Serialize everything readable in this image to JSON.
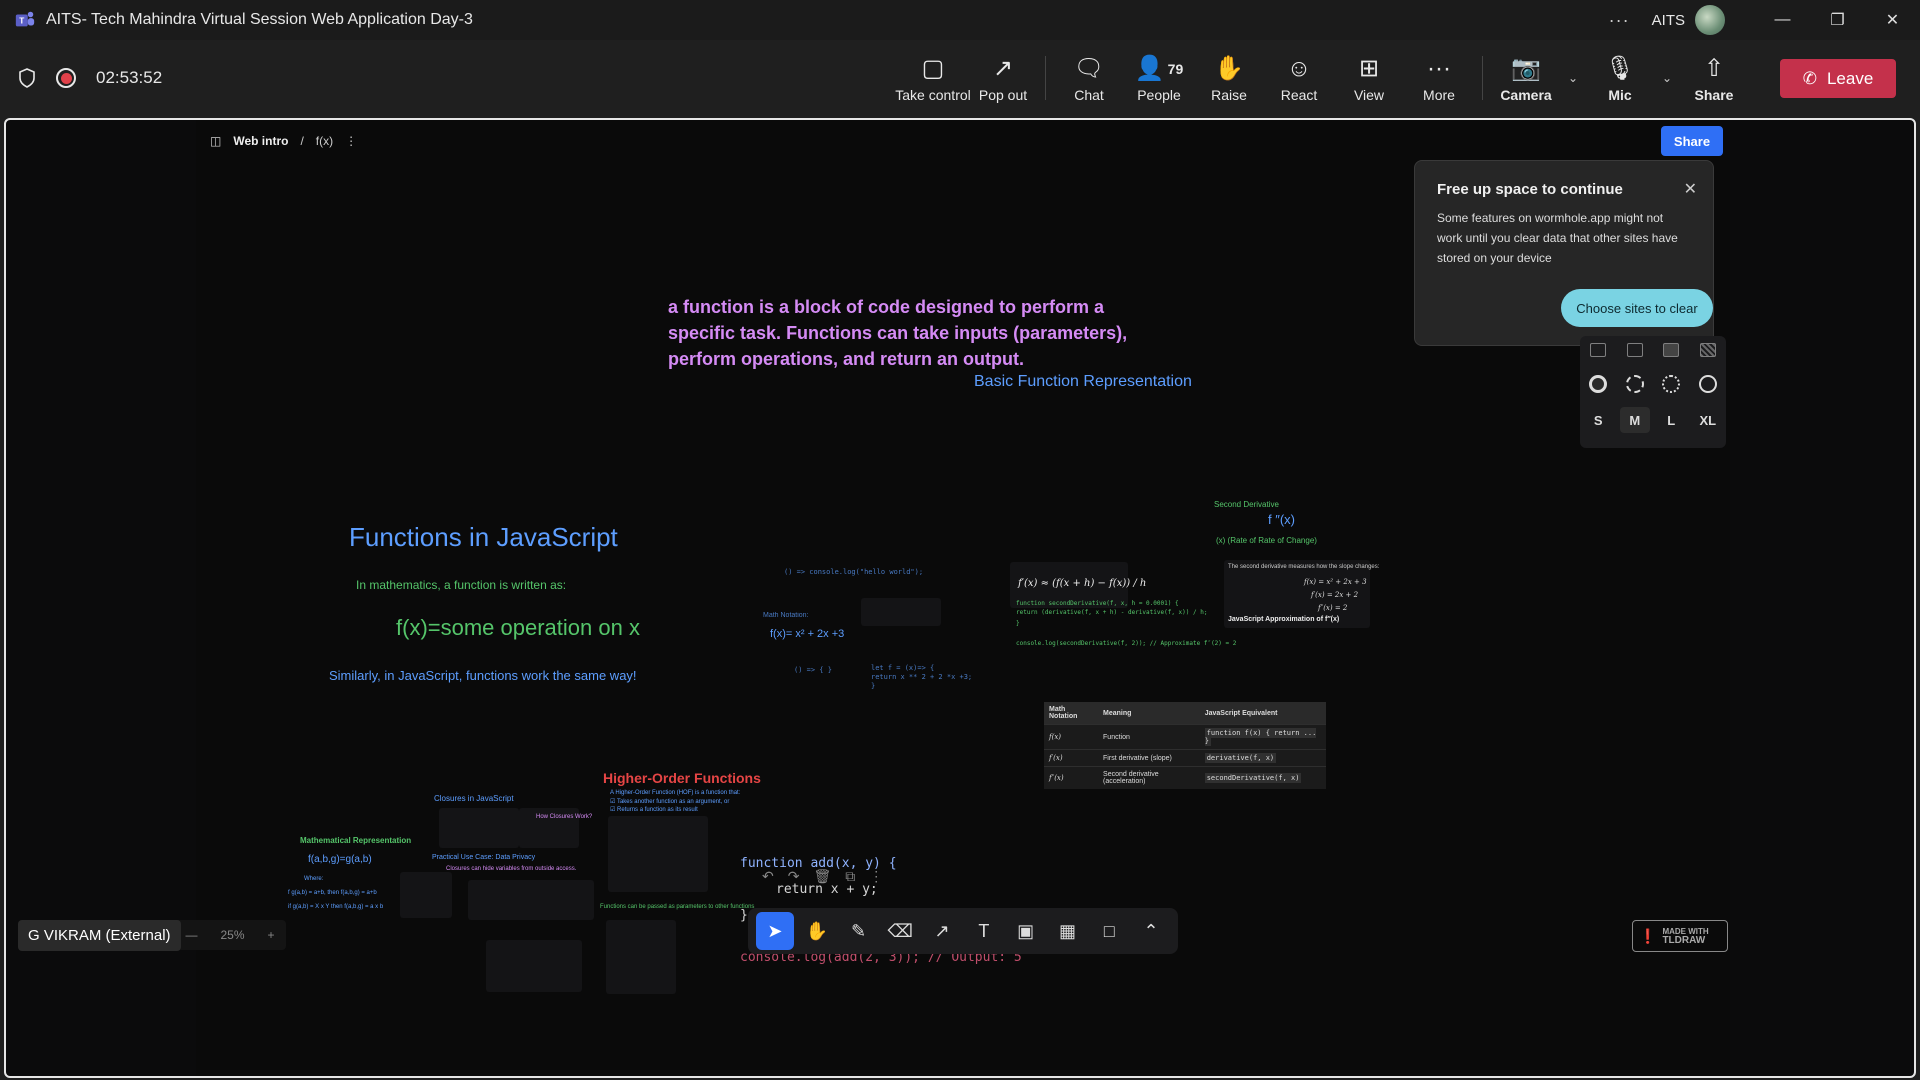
{
  "window": {
    "title": "AITS- Tech Mahindra Virtual Session Web Application Day-3",
    "org": "AITS"
  },
  "meeting": {
    "timer": "02:53:52",
    "people_count": "79",
    "tools": {
      "take_control": "Take control",
      "pop_out": "Pop out",
      "chat": "Chat",
      "people": "People",
      "raise": "Raise",
      "react": "React",
      "view": "View",
      "more": "More",
      "camera": "Camera",
      "mic": "Mic",
      "share": "Share"
    },
    "leave_label": "Leave",
    "speaker": "G VIKRAM (External)"
  },
  "board": {
    "breadcrumb_section": "Web intro",
    "breadcrumb_page": "f(x)",
    "share_label": "Share",
    "zoom": "25%",
    "made_with_line1": "MADE WITH",
    "made_with_line2": "TLDRAW"
  },
  "popup": {
    "title": "Free up space to continue",
    "body": "Some features on wormhole.app might not work until you clear data that other sites have stored on your device",
    "button": "Choose sites to clear"
  },
  "style_panel": {
    "sizes": [
      "S",
      "M",
      "L",
      "XL"
    ],
    "selected_size": "M"
  },
  "content": {
    "definition_line1": " a function is a block of code designed to perform a",
    "definition_line2": "specific task. Functions can take inputs (parameters),",
    "definition_line3": "perform operations, and return an output.",
    "basic_rep": "Basic Function Representation",
    "heading": "Functions in JavaScript",
    "math_intro": "In mathematics, a function is written as:",
    "fx": "f(x)=some operation on x",
    "similarly": "Similarly, in JavaScript, functions work the same way!",
    "console_hello": "() => console.log(\"hello world\");",
    "math_notation": "Math Notation:",
    "fx_poly": "f(x)= x² + 2x +3",
    "arrow_small": "() => { }",
    "let_f": "let f = (x)=> {",
    "let_f2": "  return x ** 2 + 2 *x +3;",
    "let_f3": "}",
    "deriv_formula": "f′(x) ≈ (f(x + h) − f(x)) / h",
    "second_deriv_title": "Second Derivative",
    "f_double_prime": "f ″(x)",
    "rate_of_rate": "(x) (Rate of Rate of Change)",
    "second_desc": "The second derivative measures how the slope changes:",
    "poly1": "f(x) = x² + 2x + 3",
    "poly2": "f′(x) = 2x + 2",
    "poly3": "f″(x) = 2",
    "js_approx": "JavaScript Approximation of f″(x)",
    "code_second1": "function secondDerivative(f, x, h = 0.0001) {",
    "code_second2": "  return (derivative(f, x + h) - derivative(f, x)) / h;",
    "code_second3": "}",
    "code_console": "console.log(secondDerivative(f, 2)); // Approximate f″(2) = 2",
    "table_headers": [
      "Math Notation",
      "Meaning",
      "JavaScript Equivalent"
    ],
    "table_rows": [
      [
        "f(x)",
        "Function",
        "function f(x) { return ... }"
      ],
      [
        "f′(x)",
        "First derivative (slope)",
        "derivative(f, x)"
      ],
      [
        "f″(x)",
        "Second derivative (acceleration)",
        "secondDerivative(f, x)"
      ]
    ],
    "closures_title": "Closures in JavaScript",
    "how_closures": "How Closures Work?",
    "math_rep": "Mathematical Representation",
    "fabg": "f(a,b,g)=g(a,b)",
    "where": "Where:",
    "where1": "f g(a,b) = a+b, then f(a,b,g) = a+b",
    "where2": "if g(a,b) = X x Y then f(a,b,g) = a x b",
    "practical": "Practical Use Case: Data Privacy",
    "closures_hide": "Closures can hide variables from outside access.",
    "hof_title": "Higher-Order Functions",
    "hof_def": "A Higher-Order Function (HOF) is a function that:",
    "hof_b1": "Takes another function as an argument, or",
    "hof_b2": "Returns a function as its result",
    "hof_passed": "Functions can be passed as parameters to other functions",
    "add_line1": "function add(x, y) {",
    "add_line2": "return x + y;",
    "add_line3": "}",
    "add_log": "console.log(add(2, 3)); // Output: 5"
  },
  "colors": {
    "accent_blue": "#2f6ff5",
    "leave_red": "#c4314b",
    "popup_button": "#7ad3e3",
    "purple_text": "#d58bf5",
    "code_blue": "#5d9eff",
    "code_green": "#55c56a",
    "hof_red": "#e64545"
  }
}
